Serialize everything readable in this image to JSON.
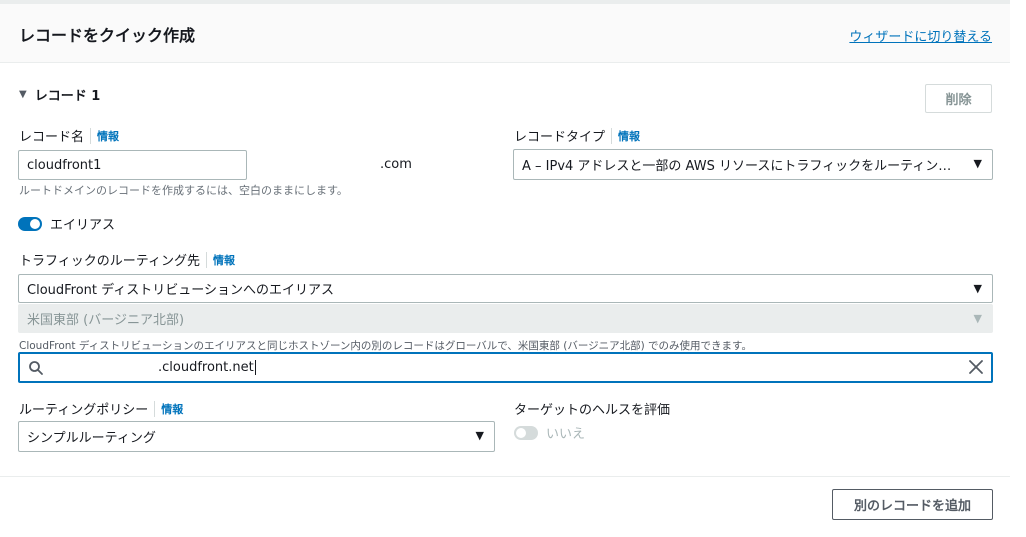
{
  "header": {
    "title": "レコードをクイック作成",
    "wizard_link": "ウィザードに切り替える"
  },
  "record": {
    "section_title": "レコード 1",
    "delete_label": "削除",
    "name_label": "レコード名",
    "info_label": "情報",
    "name_value": "cloudfront1",
    "domain_suffix": ".com",
    "name_hint": "ルートドメインのレコードを作成するには、空白のままにします。",
    "type_label": "レコードタイプ",
    "type_value": "A – IPv4 アドレスと一部の AWS リソースにトラフィックをルーティン…",
    "alias_label": "エイリアス",
    "alias_on": true,
    "route_label": "トラフィックのルーティング先",
    "route_target_value": "CloudFront ディストリビューションへのエイリアス",
    "region_value": "米国東部 (バージニア北部)",
    "region_hint": "CloudFront ディストリビューションのエイリアスと同じホストゾーン内の別のレコードはグローバルで、米国東部 (バージニア北部) でのみ使用できます。",
    "search_value": ".cloudfront.net",
    "policy_label": "ルーティングポリシー",
    "policy_value": "シンプルルーティング",
    "health_label": "ターゲットのヘルスを評価",
    "health_value": "いいえ",
    "health_on": false
  },
  "footer": {
    "add_label": "別のレコードを追加"
  },
  "colors": {
    "accent": "#0073bb",
    "text": "#16191f",
    "muted": "#687078"
  }
}
